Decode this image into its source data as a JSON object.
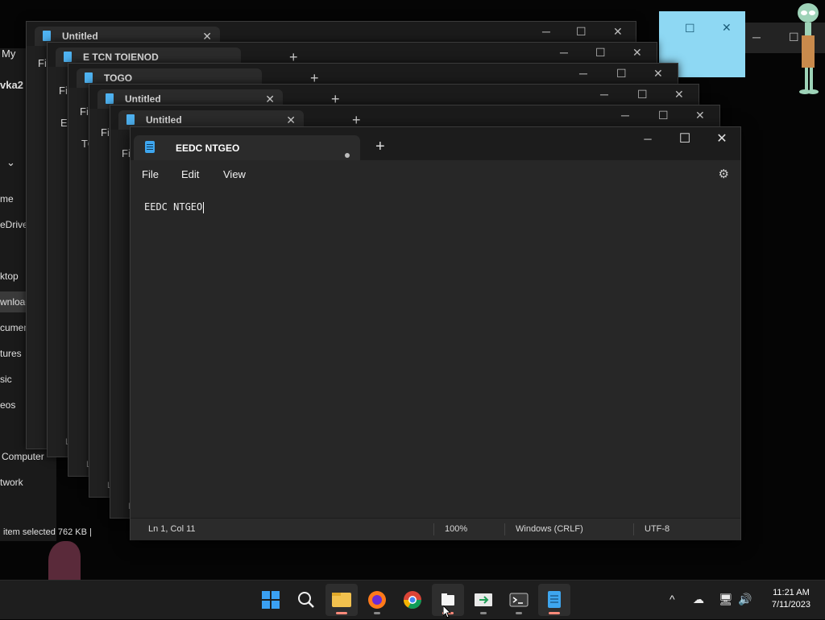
{
  "background_windows": {
    "explorer": {
      "title_partial": "vka2",
      "menu_partial": "My",
      "nav_items": [
        "me",
        "eDrive",
        "ktop",
        "wnloads",
        "cuments",
        "tures",
        "sic",
        "eos",
        "Computer",
        "twork"
      ],
      "status": "item selected  762 KB  |"
    },
    "notepad_tabs": [
      {
        "title": "Untitled",
        "menu_partial": "Fil"
      },
      {
        "title": "E TCN TOIENOD",
        "menu_partial": "Fil"
      },
      {
        "title": "TOGO",
        "menu_partial": "Fi"
      },
      {
        "title": "Untitled",
        "menu_partial": "Fi"
      },
      {
        "title": "Untitled",
        "menu_partial": "Fi"
      }
    ],
    "side_fragments": {
      "e": "E",
      "to": "TO"
    },
    "footer_fragment": "L"
  },
  "notepad": {
    "tab_title": "EEDC NTGEO",
    "tab_plus": "+",
    "window_controls": {
      "minimize": "─",
      "maximize": "☐",
      "close": "✕"
    },
    "menu": {
      "file": "File",
      "edit": "Edit",
      "view": "View"
    },
    "settings_icon": "gear-icon",
    "content": "EEDC NTGEO",
    "status": {
      "position": "Ln 1, Col 11",
      "zoom": "100%",
      "line_ending": "Windows (CRLF)",
      "encoding": "UTF-8"
    }
  },
  "taskbar": {
    "icons": [
      "start-icon",
      "search-icon",
      "file-explorer-icon",
      "firefox-icon",
      "chrome-icon",
      "files-icon",
      "remote-icon",
      "terminal-icon",
      "notepad-icon"
    ],
    "tray": {
      "chevron": "^",
      "time": "11:21 AM",
      "date": "7/11/2023"
    }
  },
  "colors": {
    "accent": "#3ea6ef",
    "active_indicator": "#ff8a7a",
    "window_bg": "#272727",
    "title_bg": "#1c1c1c"
  }
}
